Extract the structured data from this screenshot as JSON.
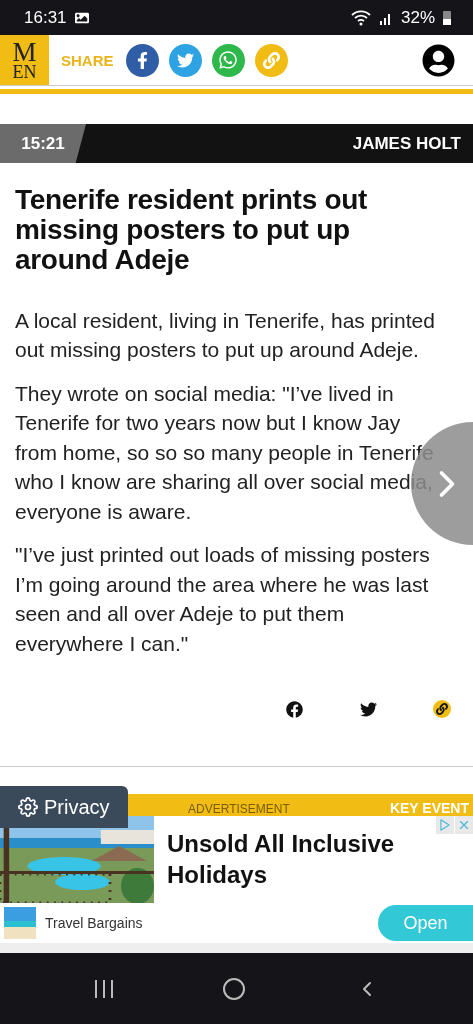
{
  "status_bar": {
    "time": "16:31",
    "battery": "32%"
  },
  "header": {
    "logo_top": "M",
    "logo_bottom": "EN",
    "share_label": "SHARE"
  },
  "byline": {
    "time": "15:21",
    "author": "JAMES HOLT"
  },
  "article": {
    "headline": "Tenerife resident prints out missing posters to put up around Adeje",
    "paragraphs": [
      "A local resident, living in Tenerife, has printed out missing posters to put up around Adeje.",
      "They wrote on social media: \"I’ve lived in Tenerife for two years now but I know Jay from home, so so so many people in Tenerife who I know are sharing all over social media, everyone is aware.",
      "\"I’ve just printed out loads of missing posters I’m going around the area where he was last seen and all over Adeje to put them everywhere I can.\""
    ]
  },
  "privacy": {
    "label": "Privacy"
  },
  "ad_strip": {
    "label": "ADVERTISEMENT",
    "tag": "KEY EVENT"
  },
  "ad": {
    "headline": "Unsold All Inclusive Holidays",
    "advertiser": "Travel Bargains",
    "button": "Open"
  }
}
